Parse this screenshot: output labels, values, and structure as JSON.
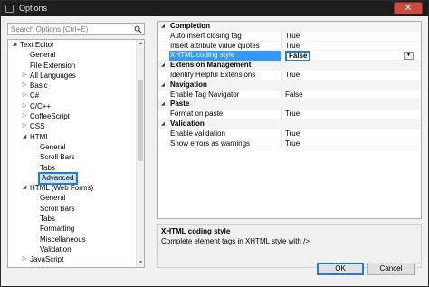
{
  "window": {
    "title": "Options",
    "close_glyph": "✕"
  },
  "search": {
    "placeholder": "Search Options (Ctrl+E)"
  },
  "tree": {
    "items": [
      {
        "label": "Text Editor",
        "depth": 0,
        "arrow": "◢"
      },
      {
        "label": "General",
        "depth": 1,
        "arrow": ""
      },
      {
        "label": "File Extension",
        "depth": 1,
        "arrow": ""
      },
      {
        "label": "All Languages",
        "depth": 1,
        "arrow": "▷"
      },
      {
        "label": "Basic",
        "depth": 1,
        "arrow": "▷"
      },
      {
        "label": "C#",
        "depth": 1,
        "arrow": "▷"
      },
      {
        "label": "C/C++",
        "depth": 1,
        "arrow": "▷"
      },
      {
        "label": "CoffeeScript",
        "depth": 1,
        "arrow": "▷"
      },
      {
        "label": "CSS",
        "depth": 1,
        "arrow": "▷"
      },
      {
        "label": "HTML",
        "depth": 1,
        "arrow": "◢"
      },
      {
        "label": "General",
        "depth": 2,
        "arrow": ""
      },
      {
        "label": "Scroll Bars",
        "depth": 2,
        "arrow": ""
      },
      {
        "label": "Tabs",
        "depth": 2,
        "arrow": ""
      },
      {
        "label": "Advanced",
        "depth": 2,
        "arrow": "",
        "selected": true
      },
      {
        "label": "HTML (Web Forms)",
        "depth": 1,
        "arrow": "◢"
      },
      {
        "label": "General",
        "depth": 2,
        "arrow": ""
      },
      {
        "label": "Scroll Bars",
        "depth": 2,
        "arrow": ""
      },
      {
        "label": "Tabs",
        "depth": 2,
        "arrow": ""
      },
      {
        "label": "Formatting",
        "depth": 2,
        "arrow": ""
      },
      {
        "label": "Miscellaneous",
        "depth": 2,
        "arrow": ""
      },
      {
        "label": "Validation",
        "depth": 2,
        "arrow": ""
      },
      {
        "label": "JavaScript",
        "depth": 1,
        "arrow": "▷"
      }
    ]
  },
  "grid": {
    "rows": [
      {
        "type": "cat",
        "name": "Completion",
        "tri": "◢"
      },
      {
        "type": "prop",
        "name": "Auto insert closing tag",
        "value": "True"
      },
      {
        "type": "prop",
        "name": "Insert attribute value quotes",
        "value": "True"
      },
      {
        "type": "prop",
        "name": "XHTML coding style",
        "value": "False",
        "selected": true
      },
      {
        "type": "cat",
        "name": "Extension Management",
        "tri": "◢"
      },
      {
        "type": "prop",
        "name": "Identify Helpful Extensions",
        "value": "True"
      },
      {
        "type": "cat",
        "name": "Navigation",
        "tri": "◢"
      },
      {
        "type": "prop",
        "name": "Enable Tag Navigator",
        "value": "False"
      },
      {
        "type": "cat",
        "name": "Paste",
        "tri": "◢"
      },
      {
        "type": "prop",
        "name": "Format on paste",
        "value": "True"
      },
      {
        "type": "cat",
        "name": "Validation",
        "tri": "◢"
      },
      {
        "type": "prop",
        "name": "Enable validation",
        "value": "True"
      },
      {
        "type": "prop",
        "name": "Show errors as warnings",
        "value": "True"
      }
    ]
  },
  "description": {
    "title": "XHTML coding style",
    "text": "Complete element tags in XHTML style with />"
  },
  "buttons": {
    "ok": "OK",
    "cancel": "Cancel"
  },
  "colors": {
    "selection_border": "#1f7ed4",
    "grid_selection": "#3399ff",
    "tree_selection": "#cce4f7"
  }
}
